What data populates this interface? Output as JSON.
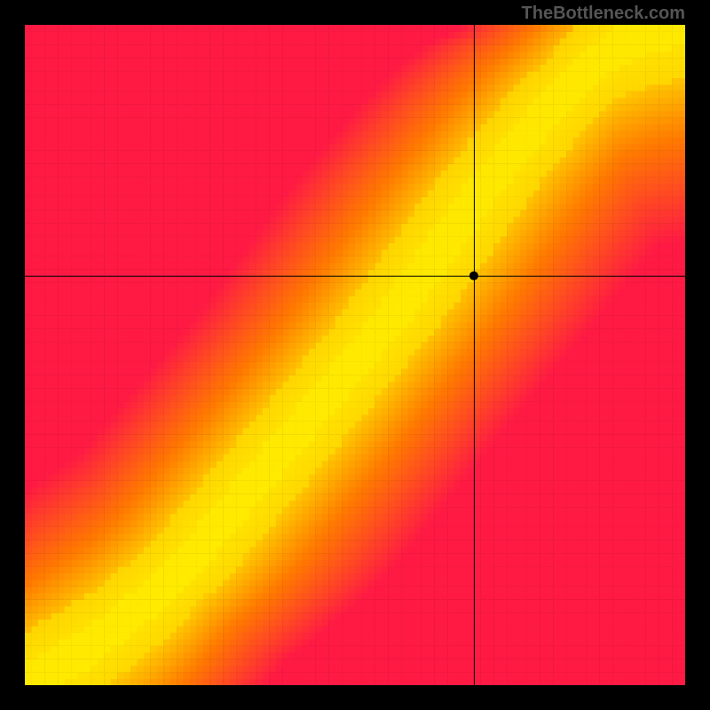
{
  "watermark": "TheBottleneck.com",
  "chart_data": {
    "type": "heatmap",
    "title": "",
    "xlabel": "",
    "ylabel": "",
    "xlim": [
      0,
      100
    ],
    "ylim": [
      0,
      100
    ],
    "grid_size": 100,
    "crosshair": {
      "x": 68,
      "y": 62
    },
    "marker": {
      "x": 68,
      "y": 62
    },
    "optimal_curve": [
      {
        "x": 0,
        "y": 0
      },
      {
        "x": 5,
        "y": 3
      },
      {
        "x": 10,
        "y": 6
      },
      {
        "x": 15,
        "y": 10
      },
      {
        "x": 20,
        "y": 14
      },
      {
        "x": 25,
        "y": 19
      },
      {
        "x": 30,
        "y": 25
      },
      {
        "x": 35,
        "y": 31
      },
      {
        "x": 40,
        "y": 37
      },
      {
        "x": 45,
        "y": 43
      },
      {
        "x": 50,
        "y": 49
      },
      {
        "x": 55,
        "y": 55
      },
      {
        "x": 60,
        "y": 62
      },
      {
        "x": 65,
        "y": 69
      },
      {
        "x": 70,
        "y": 76
      },
      {
        "x": 75,
        "y": 82
      },
      {
        "x": 80,
        "y": 88
      },
      {
        "x": 85,
        "y": 93
      },
      {
        "x": 90,
        "y": 97
      },
      {
        "x": 95,
        "y": 99
      },
      {
        "x": 100,
        "y": 100
      }
    ],
    "colorscale": [
      {
        "stop": 0.0,
        "color": "#ff1a44"
      },
      {
        "stop": 0.35,
        "color": "#ff7a00"
      },
      {
        "stop": 0.6,
        "color": "#ffd600"
      },
      {
        "stop": 0.78,
        "color": "#fff200"
      },
      {
        "stop": 0.88,
        "color": "#e0ff3a"
      },
      {
        "stop": 0.95,
        "color": "#7aff60"
      },
      {
        "stop": 1.0,
        "color": "#00e68a"
      }
    ],
    "band_width": 8
  }
}
